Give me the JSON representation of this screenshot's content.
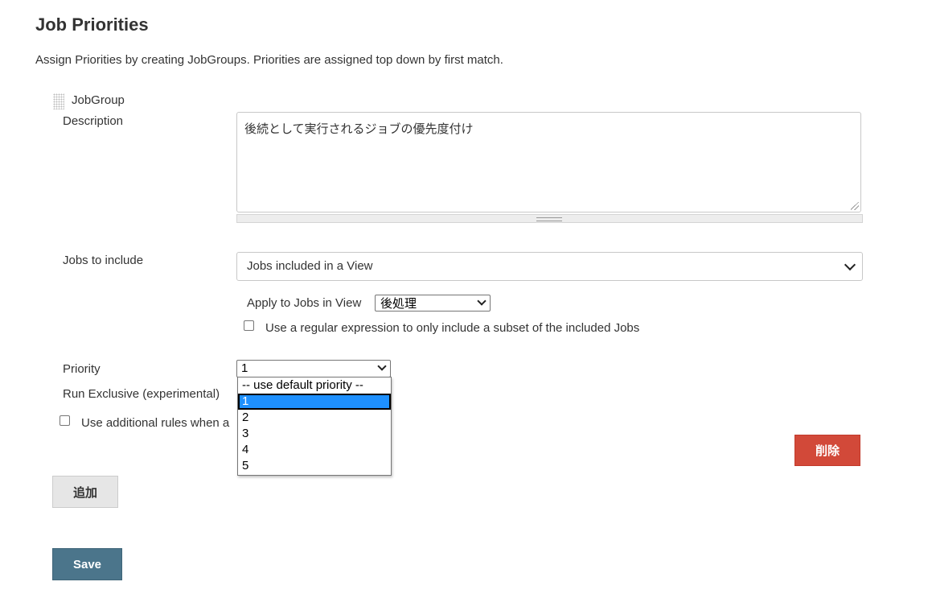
{
  "page": {
    "title": "Job Priorities",
    "subtitle": "Assign Priorities by creating JobGroups. Priorities are assigned top down by first match."
  },
  "job_group": {
    "label": "JobGroup",
    "description_label": "Description",
    "description_value": "後続として実行されるジョブの優先度付け",
    "jobs_to_include_label": "Jobs to include",
    "jobs_to_include_value": "Jobs included in a View",
    "apply_to_view_label": "Apply to Jobs in View",
    "apply_to_view_value": "後処理",
    "regex_checkbox_label": "Use a regular expression to only include a subset of the included Jobs",
    "regex_checked": false,
    "priority_label": "Priority",
    "priority_value": "1",
    "priority_options": [
      "-- use default priority --",
      "1",
      "2",
      "3",
      "4",
      "5"
    ],
    "priority_selected_index": 1,
    "run_exclusive_label": "Run Exclusive (experimental)",
    "additional_rules_label": "Use additional rules when a",
    "additional_rules_checked": false,
    "delete_button": "削除"
  },
  "actions": {
    "add_button": "追加",
    "save_button": "Save"
  },
  "colors": {
    "delete": "#d24939",
    "save": "#4b758b",
    "selected_option": "#1e90ff"
  }
}
